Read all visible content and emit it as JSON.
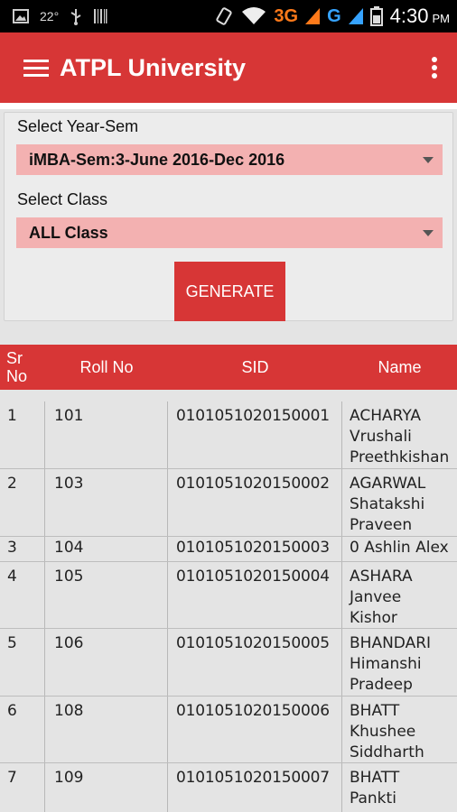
{
  "status_bar": {
    "temperature": "22°",
    "network_3g": "3G",
    "network_g": "G",
    "time": "4:30",
    "ampm": "PM",
    "icons": [
      "image-icon",
      "usb-icon",
      "barcode-icon",
      "rotate-icon",
      "wifi-icon",
      "signal-icon",
      "battery-icon"
    ]
  },
  "appbar": {
    "title": "ATPL University",
    "color": "#d73636"
  },
  "form": {
    "year_sem_label": "Select Year-Sem",
    "year_sem_value": "iMBA-Sem:3-June 2016-Dec 2016",
    "class_label": "Select Class",
    "class_value": "ALL Class",
    "generate_label": "GENERATE"
  },
  "table": {
    "headers": {
      "sr": "Sr\nNo",
      "roll": "Roll No",
      "sid": "SID",
      "name": "Name"
    },
    "rows": [
      {
        "sr": "1",
        "roll": "101",
        "sid": "0101051020150001",
        "name": "ACHARYA\nVrushali\nPreethkishan"
      },
      {
        "sr": "2",
        "roll": "103",
        "sid": "0101051020150002",
        "name": "AGARWAL\nShatakshi\nPraveen"
      },
      {
        "sr": "3",
        "roll": "104",
        "sid": "0101051020150003",
        "name": "0 Ashlin Alex"
      },
      {
        "sr": "4",
        "roll": "105",
        "sid": "0101051020150004",
        "name": "ASHARA\nJanvee\nKishor"
      },
      {
        "sr": "5",
        "roll": "106",
        "sid": "0101051020150005",
        "name": "BHANDARI\nHimanshi\nPradeep"
      },
      {
        "sr": "6",
        "roll": "108",
        "sid": "0101051020150006",
        "name": "BHATT\nKhushee\nSiddharth"
      },
      {
        "sr": "7",
        "roll": "109",
        "sid": "0101051020150007",
        "name": "BHATT\nPankti"
      }
    ]
  }
}
